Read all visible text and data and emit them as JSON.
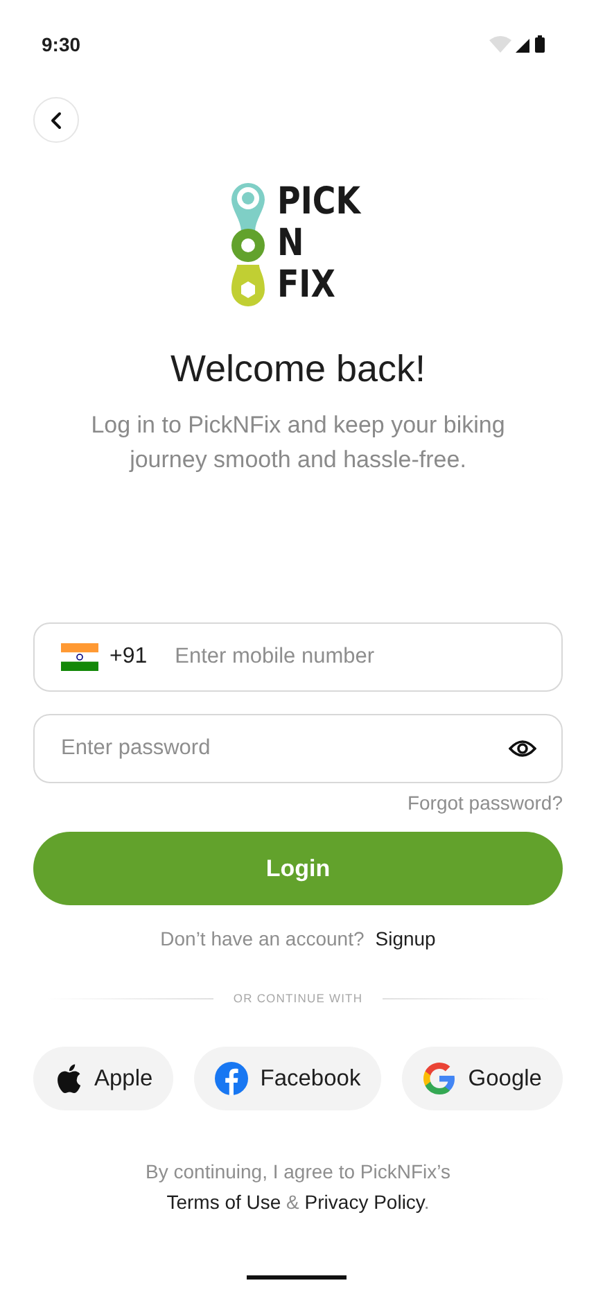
{
  "status_bar": {
    "time": "9:30"
  },
  "logo": {
    "lines": [
      "PICK",
      "N",
      "FIX"
    ]
  },
  "title": "Welcome back!",
  "subtitle": "Log in to PickNFix and keep your biking journey smooth and hassle-free.",
  "phone_field": {
    "country_code": "+91",
    "placeholder": "Enter mobile number"
  },
  "password_field": {
    "placeholder": "Enter password",
    "visible": false
  },
  "forgot_link": "Forgot password?",
  "login_button": "Login",
  "signup_prompt": {
    "text": "Don’t have an account?",
    "link": "Signup"
  },
  "divider_label": "OR CONTINUE WITH",
  "social_buttons": [
    {
      "kind": "apple",
      "label": "Apple"
    },
    {
      "kind": "facebook",
      "label": "Facebook"
    },
    {
      "kind": "google",
      "label": "Google"
    }
  ],
  "terms": {
    "text": "By continuing, I agree to PickNFix’s",
    "link_1": "Terms of Use",
    "joiner": "&",
    "link_2": "Privacy Policy",
    "end": "."
  }
}
